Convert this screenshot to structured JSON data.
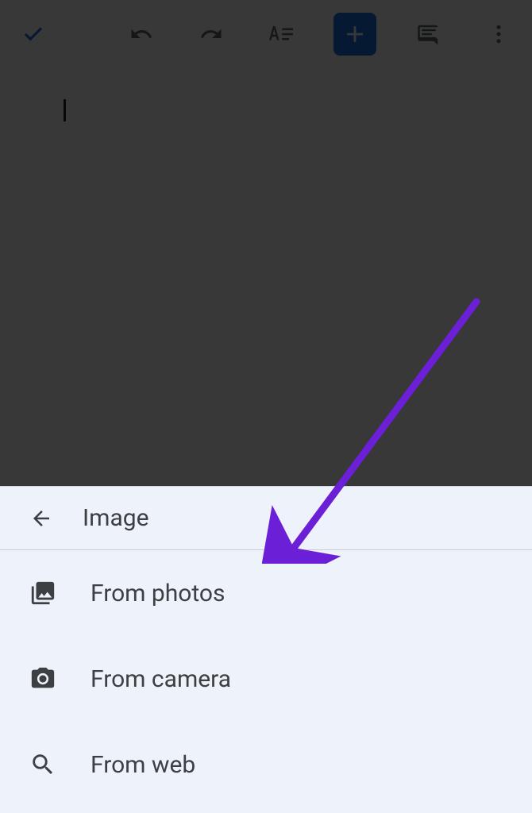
{
  "toolbar": {
    "check_label": "Done",
    "undo_label": "Undo",
    "redo_label": "Redo",
    "format_label": "Format",
    "insert_label": "Insert",
    "comment_label": "Comments",
    "more_label": "More"
  },
  "sheet": {
    "title": "Image",
    "back_label": "Back",
    "items": [
      {
        "label": "From photos",
        "icon": "photos"
      },
      {
        "label": "From camera",
        "icon": "camera"
      },
      {
        "label": "From web",
        "icon": "search"
      }
    ]
  },
  "annotation": {
    "arrow_color": "#6b1fd6"
  }
}
